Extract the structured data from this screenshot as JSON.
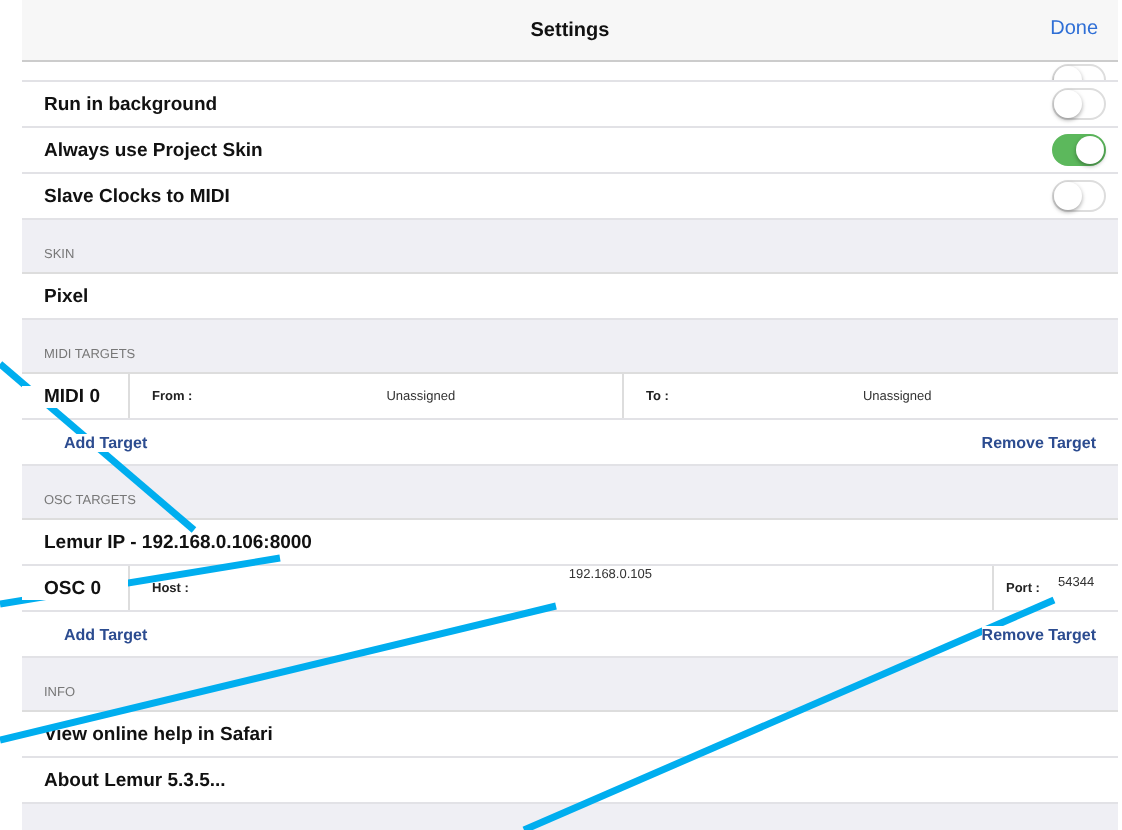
{
  "header": {
    "title": "Settings",
    "done": "Done"
  },
  "partial_toggle": {
    "on": false
  },
  "toggles": [
    {
      "label": "Run in background",
      "on": false
    },
    {
      "label": "Always use Project Skin",
      "on": true
    },
    {
      "label": "Slave Clocks to MIDI",
      "on": false
    }
  ],
  "skin": {
    "heading": "SKIN",
    "value": "Pixel"
  },
  "midi_targets": {
    "heading": "MIDI TARGETS",
    "name": "MIDI 0",
    "from_label": "From :",
    "from_value": "Unassigned",
    "to_label": "To :",
    "to_value": "Unassigned",
    "add": "Add Target",
    "remove": "Remove Target"
  },
  "osc_targets": {
    "heading": "OSC TARGETS",
    "lemur_ip": "Lemur IP - 192.168.0.106:8000",
    "name": "OSC 0",
    "host_label": "Host :",
    "host_value": "192.168.0.105",
    "port_label": "Port :",
    "port_value": "54344",
    "add": "Add Target",
    "remove": "Remove Target"
  },
  "info": {
    "heading": "INFO",
    "items": [
      "View online help in Safari",
      "About Lemur 5.3.5..."
    ]
  }
}
